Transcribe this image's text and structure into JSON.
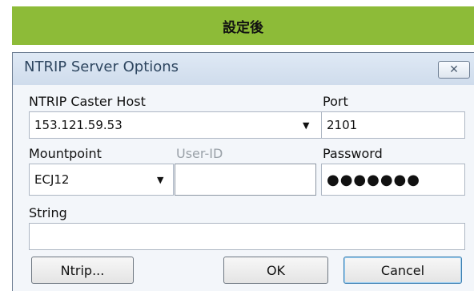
{
  "banner": {
    "text": "設定後"
  },
  "window": {
    "title": "NTRIP Server Options",
    "close_icon": "close-icon"
  },
  "form": {
    "caster_host": {
      "label": "NTRIP Caster Host",
      "value": "153.121.59.53"
    },
    "port": {
      "label": "Port",
      "value": "2101"
    },
    "mountpoint": {
      "label": "Mountpoint",
      "value": "ECJ12"
    },
    "user_id": {
      "label": "User-ID",
      "value": ""
    },
    "password": {
      "label": "Password",
      "value": "●●●●●●●"
    },
    "string": {
      "label": "String",
      "value": ""
    }
  },
  "buttons": {
    "ntrip": "Ntrip...",
    "ok": "OK",
    "cancel": "Cancel"
  },
  "colors": {
    "banner": "#8dbb38",
    "titlebar": "#d7e3f1",
    "dialog_bg": "#f3f6fa"
  }
}
